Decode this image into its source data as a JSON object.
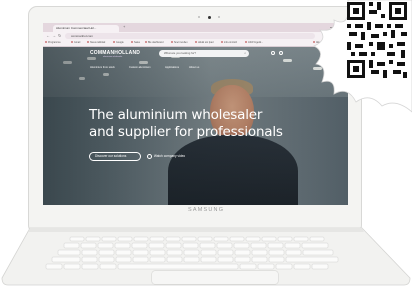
{
  "device": {
    "brand": "SAMSUNG"
  },
  "browser": {
    "tab_title": "Aluminium Commerciaal Hol...",
    "url": "commanhol.com",
    "bookmarks": [
      "Programma",
      "Gmail",
      "Nieuw tabblad",
      "Google",
      "Sales",
      "Blé dashboard",
      "Snel invullen",
      "dokkk sto Ipad",
      "info.omnitoh",
      "ASW Ingetik...",
      "Alle bladwijzers"
    ]
  },
  "site": {
    "logo": "COMMANHOLLAND",
    "logo_sub": "aluminium wholesaler",
    "search_placeholder": "What are you looking for?",
    "nav_items": [
      "Aluminium from stock",
      "Custom aluminium",
      "Applications",
      "About us"
    ],
    "hero": {
      "line1": "The aluminium wholesaler",
      "line2": "and supplier for professionals",
      "cta_primary": "Discover our solutions",
      "cta_secondary": "Watch company video"
    }
  },
  "colors": {
    "headline": "#ffffff",
    "tabbar": "#e4d7de",
    "lid": "#f4f4f2"
  }
}
